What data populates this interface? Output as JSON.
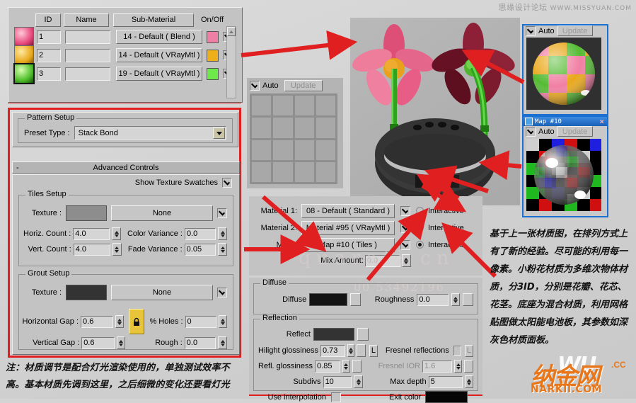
{
  "watermark": {
    "cn": "思缘设计论坛",
    "en": "WWW.MISSYUAN.COM",
    "ghost1": "quarati cn",
    "ghost2": "00 53492196"
  },
  "material_list": {
    "headers": {
      "id": "ID",
      "name": "Name",
      "sub_material": "Sub-Material",
      "on_off": "On/Off"
    },
    "rows": [
      {
        "id": "1",
        "name": "",
        "sub_material": "14 - Default  ( Blend )",
        "color": "#ef7fa5",
        "enabled": true,
        "selected": false
      },
      {
        "id": "2",
        "name": "",
        "sub_material": "14 - Default  ( VRayMtl )",
        "color": "#eeb01a",
        "enabled": true,
        "selected": false
      },
      {
        "id": "3",
        "name": "",
        "sub_material": "19 - Default  ( VRayMtl )",
        "color": "#6de94a",
        "enabled": true,
        "selected": true
      }
    ]
  },
  "pattern_setup": {
    "group_label": "Pattern Setup",
    "preset_label": "Preset Type :",
    "preset_value": "Stack Bond"
  },
  "advanced_controls": {
    "rollout_label": "Advanced Controls",
    "rollout_sign": "-",
    "show_texture_swatches": "Show Texture Swatches",
    "show_texture_swatches_checked": true,
    "tiles_setup": {
      "group_label": "Tiles Setup",
      "texture_label": "Texture :",
      "texture_button": "None",
      "texture_enabled": true,
      "texture_swatch": "#8d8d8d",
      "horiz_count_label": "Horiz. Count :",
      "horiz_count": "4.0",
      "vert_count_label": "Vert. Count :",
      "vert_count": "4.0",
      "color_variance_label": "Color Variance :",
      "color_variance": "0.0",
      "fade_variance_label": "Fade Variance :",
      "fade_variance": "0.05"
    },
    "grout_setup": {
      "group_label": "Grout Setup",
      "texture_label": "Texture :",
      "texture_button": "None",
      "texture_enabled": true,
      "texture_swatch": "#333333",
      "horizontal_gap_label": "Horizontal Gap :",
      "horizontal_gap": "0.6",
      "vertical_gap_label": "Vertical Gap :",
      "vertical_gap": "0.6",
      "lock_icon": "lock-icon",
      "holes_label": "% Holes :",
      "holes": "0",
      "rough_label": "Rough :",
      "rough": "0.0"
    }
  },
  "tile_preview": {
    "auto_label": "Auto",
    "auto_checked": true,
    "update_label": "Update"
  },
  "blend_material": {
    "rows": [
      {
        "label": "Material 1:",
        "value": "08 - Default  ( Standard )",
        "checked": true,
        "interactive_label": "Interactive",
        "interactive_on": false
      },
      {
        "label": "Material 2:",
        "value": "Material #95  ( VRayMtl )",
        "checked": true,
        "interactive_label": "Interactive",
        "interactive_on": false
      },
      {
        "label": "Mask:",
        "value": "Map #10  ( Tiles )",
        "checked": true,
        "interactive_label": "Interactive",
        "interactive_on": true
      }
    ],
    "mix_amount_label": "Mix Amount:",
    "mix_amount": "0.0"
  },
  "vray_material": {
    "diffuse_group": "Diffuse",
    "diffuse_label": "Diffuse",
    "diffuse_color": "#141414",
    "roughness_label": "Roughness",
    "roughness": "0.0",
    "reflection_group": "Reflection",
    "reflect_label": "Reflect",
    "reflect_color": "#333333",
    "hilight_glossiness_label": "Hilight glossiness",
    "hilight_glossiness": "0.73",
    "hilight_lock": "L",
    "refl_glossiness_label": "Refl. glossiness",
    "refl_glossiness": "0.85",
    "subdivs_label": "Subdivs",
    "subdivs": "10",
    "use_interpolation_label": "Use interpolation",
    "use_interpolation_checked": false,
    "fresnel_reflections_label": "Fresnel reflections",
    "fresnel_reflections_checked": false,
    "fresnel_lock": "L",
    "fresnel_ior_label": "Fresnel IOR",
    "fresnel_ior": "1.6",
    "max_depth_label": "Max depth",
    "max_depth": "5",
    "exit_color_label": "Exit color",
    "exit_color": "#050505"
  },
  "preview_windows": [
    {
      "title": "",
      "auto_label": "Auto",
      "auto_checked": true,
      "update_label": "Update",
      "has_title_bar": false
    },
    {
      "title": "Map #10",
      "auto_label": "Auto",
      "auto_checked": true,
      "update_label": "Update",
      "has_title_bar": true,
      "close_label": "×"
    }
  ],
  "notes": {
    "left": "注：材质调节是配合灯光渲染使用的，单独测试效率不高。基本材质先调到这里，之后细微的变化还要看灯光",
    "right": "基于上一张材质图，在排列方式上有了新的经验。尽可能的利用每一像素。小粉花材质为多维次物体材质，分3ID，分别是花瓣、花芯、花茎。底座为混合材质，利用网格贴图做太阳能电池板，其参数如深灰色材质面板。"
  },
  "logo": {
    "cn": "纳金网",
    "overlay": "WU",
    "cc": ".CC",
    "domain": "NARKII.COM"
  },
  "viewport": {
    "flowers": [
      {
        "name": "pink-flower-lit",
        "petal": "#ea5f86",
        "center": "#eaa01b",
        "stem": "#3fb521"
      },
      {
        "name": "pink-flower-dark",
        "petal": "#7a1a30",
        "center": "#63c83a",
        "stem": "#3fb521"
      }
    ],
    "base_ring": {
      "name": "solar-ring",
      "color": "#2a2a2a"
    }
  },
  "colors": {
    "annotation_red": "#e02020",
    "panel_gray": "#c3c3c3",
    "accent_blue": "#1b6fd0"
  }
}
